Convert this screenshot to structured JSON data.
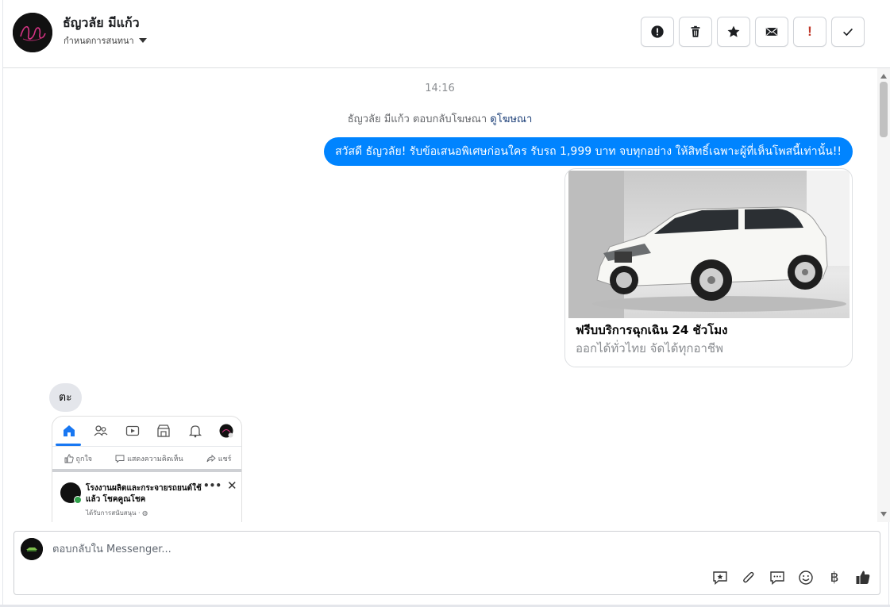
{
  "header": {
    "contact_name": "ธัญวลัย มีแก้ว",
    "assign_label": "กำหนดการสนทนา",
    "actions": [
      {
        "name": "spam-button",
        "icon": "alert-circle-icon"
      },
      {
        "name": "delete-button",
        "icon": "trash-icon"
      },
      {
        "name": "star-button",
        "icon": "star-icon"
      },
      {
        "name": "mark-unread-button",
        "icon": "envelope-icon"
      },
      {
        "name": "important-button",
        "icon": "exclamation-icon"
      },
      {
        "name": "mark-done-button",
        "icon": "check-icon"
      }
    ],
    "important_glyph": "!"
  },
  "chat": {
    "timestamp": "14:16",
    "ad_reply_text": "ธัญวลัย มีแก้ว ตอบกลับโฆษณา",
    "ad_reply_link": "ดูโฆษณา",
    "outgoing_message": "สวัสดี ธัญวลัย! รับข้อเสนอพิเศษก่อนใคร  รับรถ 1,999 บาท จบทุกอย่าง ให้สิทธิ์เฉพาะผู้ที่เห็นโพสนี้เท่านั้น!!",
    "ad_card": {
      "title": "ฟรีบบริการฉุกเฉิน 24 ชัวโมง",
      "subtitle": "ออกได้ทั่วไทย จัดได้ทุกอาชีพ"
    },
    "incoming_message": "ตะ",
    "screenshot": {
      "reactions": [
        "ถูกใจ",
        "แสดงความคิดเห็น",
        "แชร์"
      ],
      "post_name": "โรงงานผลิตและกระจายรถยนต์ใช้แล้ว โชคคูณโชค",
      "post_meta": "ได้รับการสนับสนุน · ◍",
      "menu_glyph": "•••",
      "close_glyph": "✕"
    }
  },
  "composer": {
    "placeholder": "ตอบกลับใน Messenger...",
    "baht_glyph": "฿"
  },
  "colors": {
    "accent": "#0084ff",
    "incoming_bubble": "#e4e6eb",
    "link": "#1c3f78"
  }
}
